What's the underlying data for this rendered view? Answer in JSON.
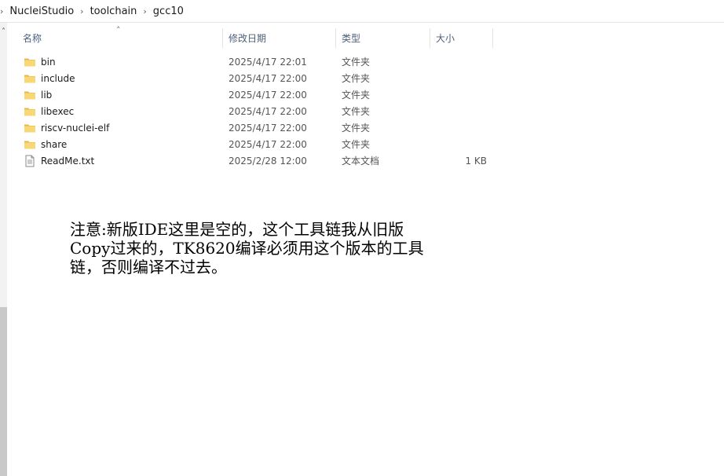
{
  "breadcrumb": {
    "items": [
      "NucleiStudio",
      "toolchain",
      "gcc10"
    ]
  },
  "columns": {
    "name": "名称",
    "date": "修改日期",
    "type": "类型",
    "size": "大小"
  },
  "files": [
    {
      "name": "bin",
      "date": "2025/4/17 22:01",
      "type": "文件夹",
      "size": "",
      "icon": "folder-icon"
    },
    {
      "name": "include",
      "date": "2025/4/17 22:00",
      "type": "文件夹",
      "size": "",
      "icon": "folder-icon"
    },
    {
      "name": "lib",
      "date": "2025/4/17 22:00",
      "type": "文件夹",
      "size": "",
      "icon": "folder-icon"
    },
    {
      "name": "libexec",
      "date": "2025/4/17 22:00",
      "type": "文件夹",
      "size": "",
      "icon": "folder-icon"
    },
    {
      "name": "riscv-nuclei-elf",
      "date": "2025/4/17 22:00",
      "type": "文件夹",
      "size": "",
      "icon": "folder-icon"
    },
    {
      "name": "share",
      "date": "2025/4/17 22:00",
      "type": "文件夹",
      "size": "",
      "icon": "folder-icon"
    },
    {
      "name": "ReadMe.txt",
      "date": "2025/2/28 12:00",
      "type": "文本文档",
      "size": "1 KB",
      "icon": "text-file-icon"
    }
  ],
  "annotation": {
    "lines": [
      "注意:新版IDE这里是空的，这个工具链我从旧版",
      "Copy过来的，TK8620编译必须用这个版本的工具",
      "链，否则编译不过去。"
    ]
  },
  "colors": {
    "folder": "#f8d775",
    "folder_dark": "#e6b84a",
    "header_text": "#4c607a"
  }
}
